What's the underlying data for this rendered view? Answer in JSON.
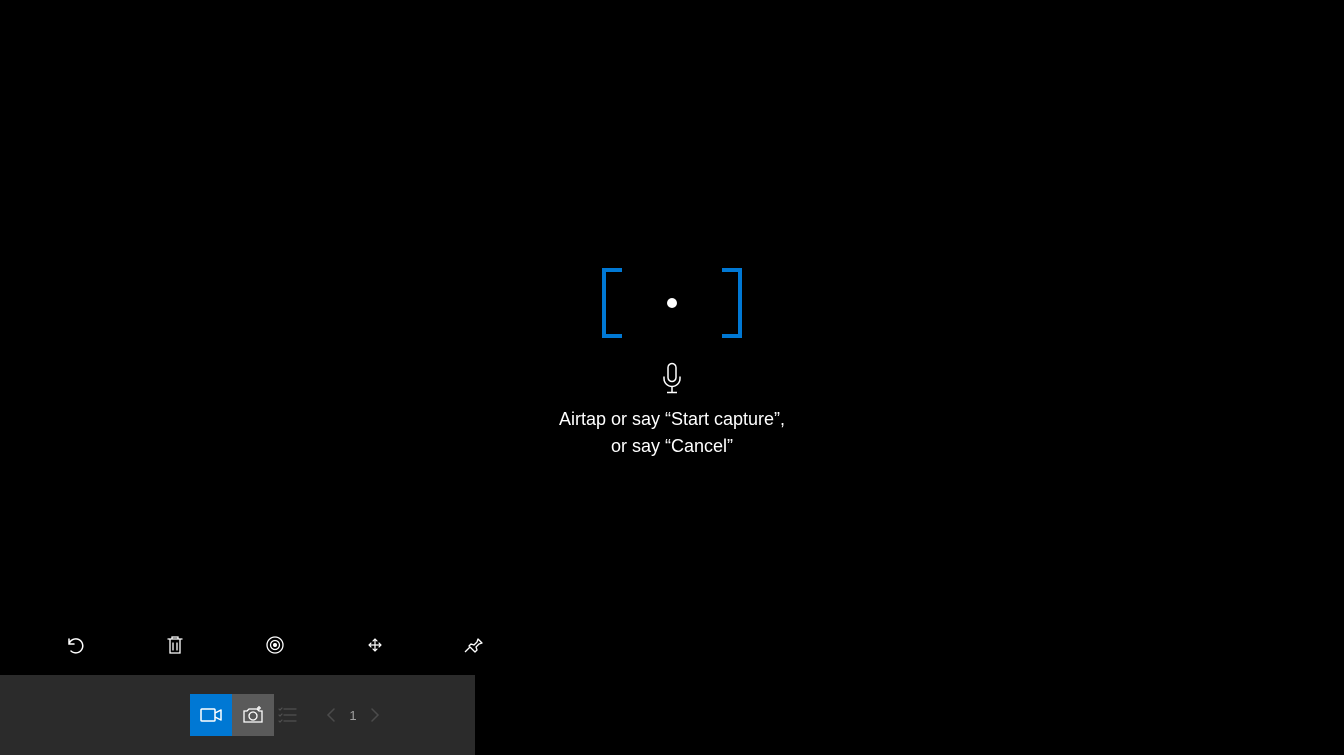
{
  "accent_color": "#0078d4",
  "reticle": {
    "bracket_color": "#0078d4"
  },
  "instruction": {
    "line1": "Airtap or say “Start capture”,",
    "line2": "or say “Cancel”"
  },
  "icons": {
    "mic": "microphone-icon",
    "undo": "undo-icon",
    "delete": "trash-icon",
    "follow": "target-icon",
    "expand": "expand-icon",
    "pin": "pin-icon",
    "video": "video-camera-icon",
    "photo": "photo-camera-icon",
    "list": "list-icon",
    "prev": "chevron-left-icon",
    "next": "chevron-right-icon"
  },
  "pager": {
    "current": "1"
  }
}
